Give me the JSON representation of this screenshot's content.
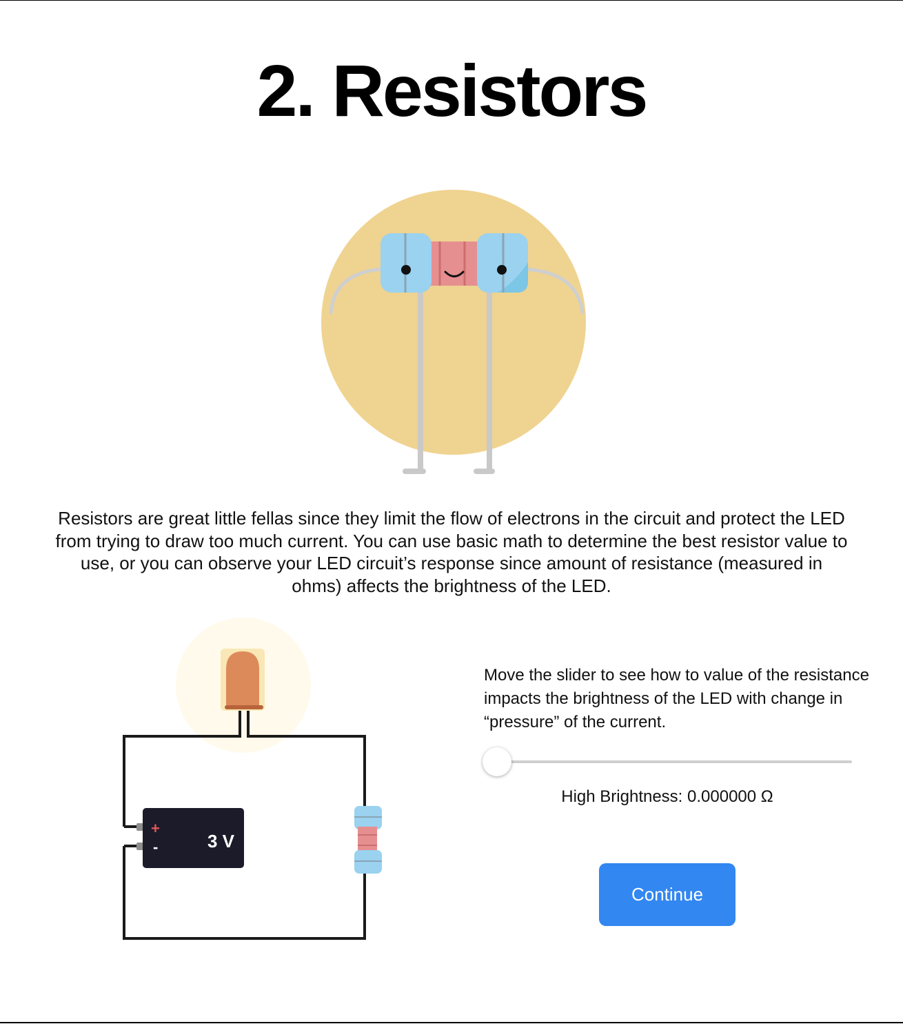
{
  "page": {
    "title": "2. Resistors",
    "intro": "Resistors are great little fellas since they limit the flow of electrons in the circuit and protect the LED from trying to draw too much current. You can use basic math to determine the best resistor value to use, or you can observe your LED circuit’s response since amount of resistance (measured in ohms) affects the brightness of the LED."
  },
  "circuit": {
    "battery_plus": "+",
    "battery_minus": "-",
    "battery_voltage": "3 V"
  },
  "control": {
    "instructions": "Move the slider to see how to value of the resistance impacts the brightness of the LED with change in “pressure” of the current.",
    "slider_value": 0,
    "brightness_label": "High Brightness: 0.000000 Ω",
    "continue_label": "Continue"
  },
  "colors": {
    "accent": "#3287f0",
    "hero_circle": "#efd390",
    "resistor_cap": "#9ad2f0",
    "resistor_body": "#e58f90",
    "led": "#dd8a5a",
    "battery": "#1c1b29"
  },
  "icons": {
    "hero": "resistor-character-illustration",
    "circuit": "led-circuit-diagram"
  }
}
